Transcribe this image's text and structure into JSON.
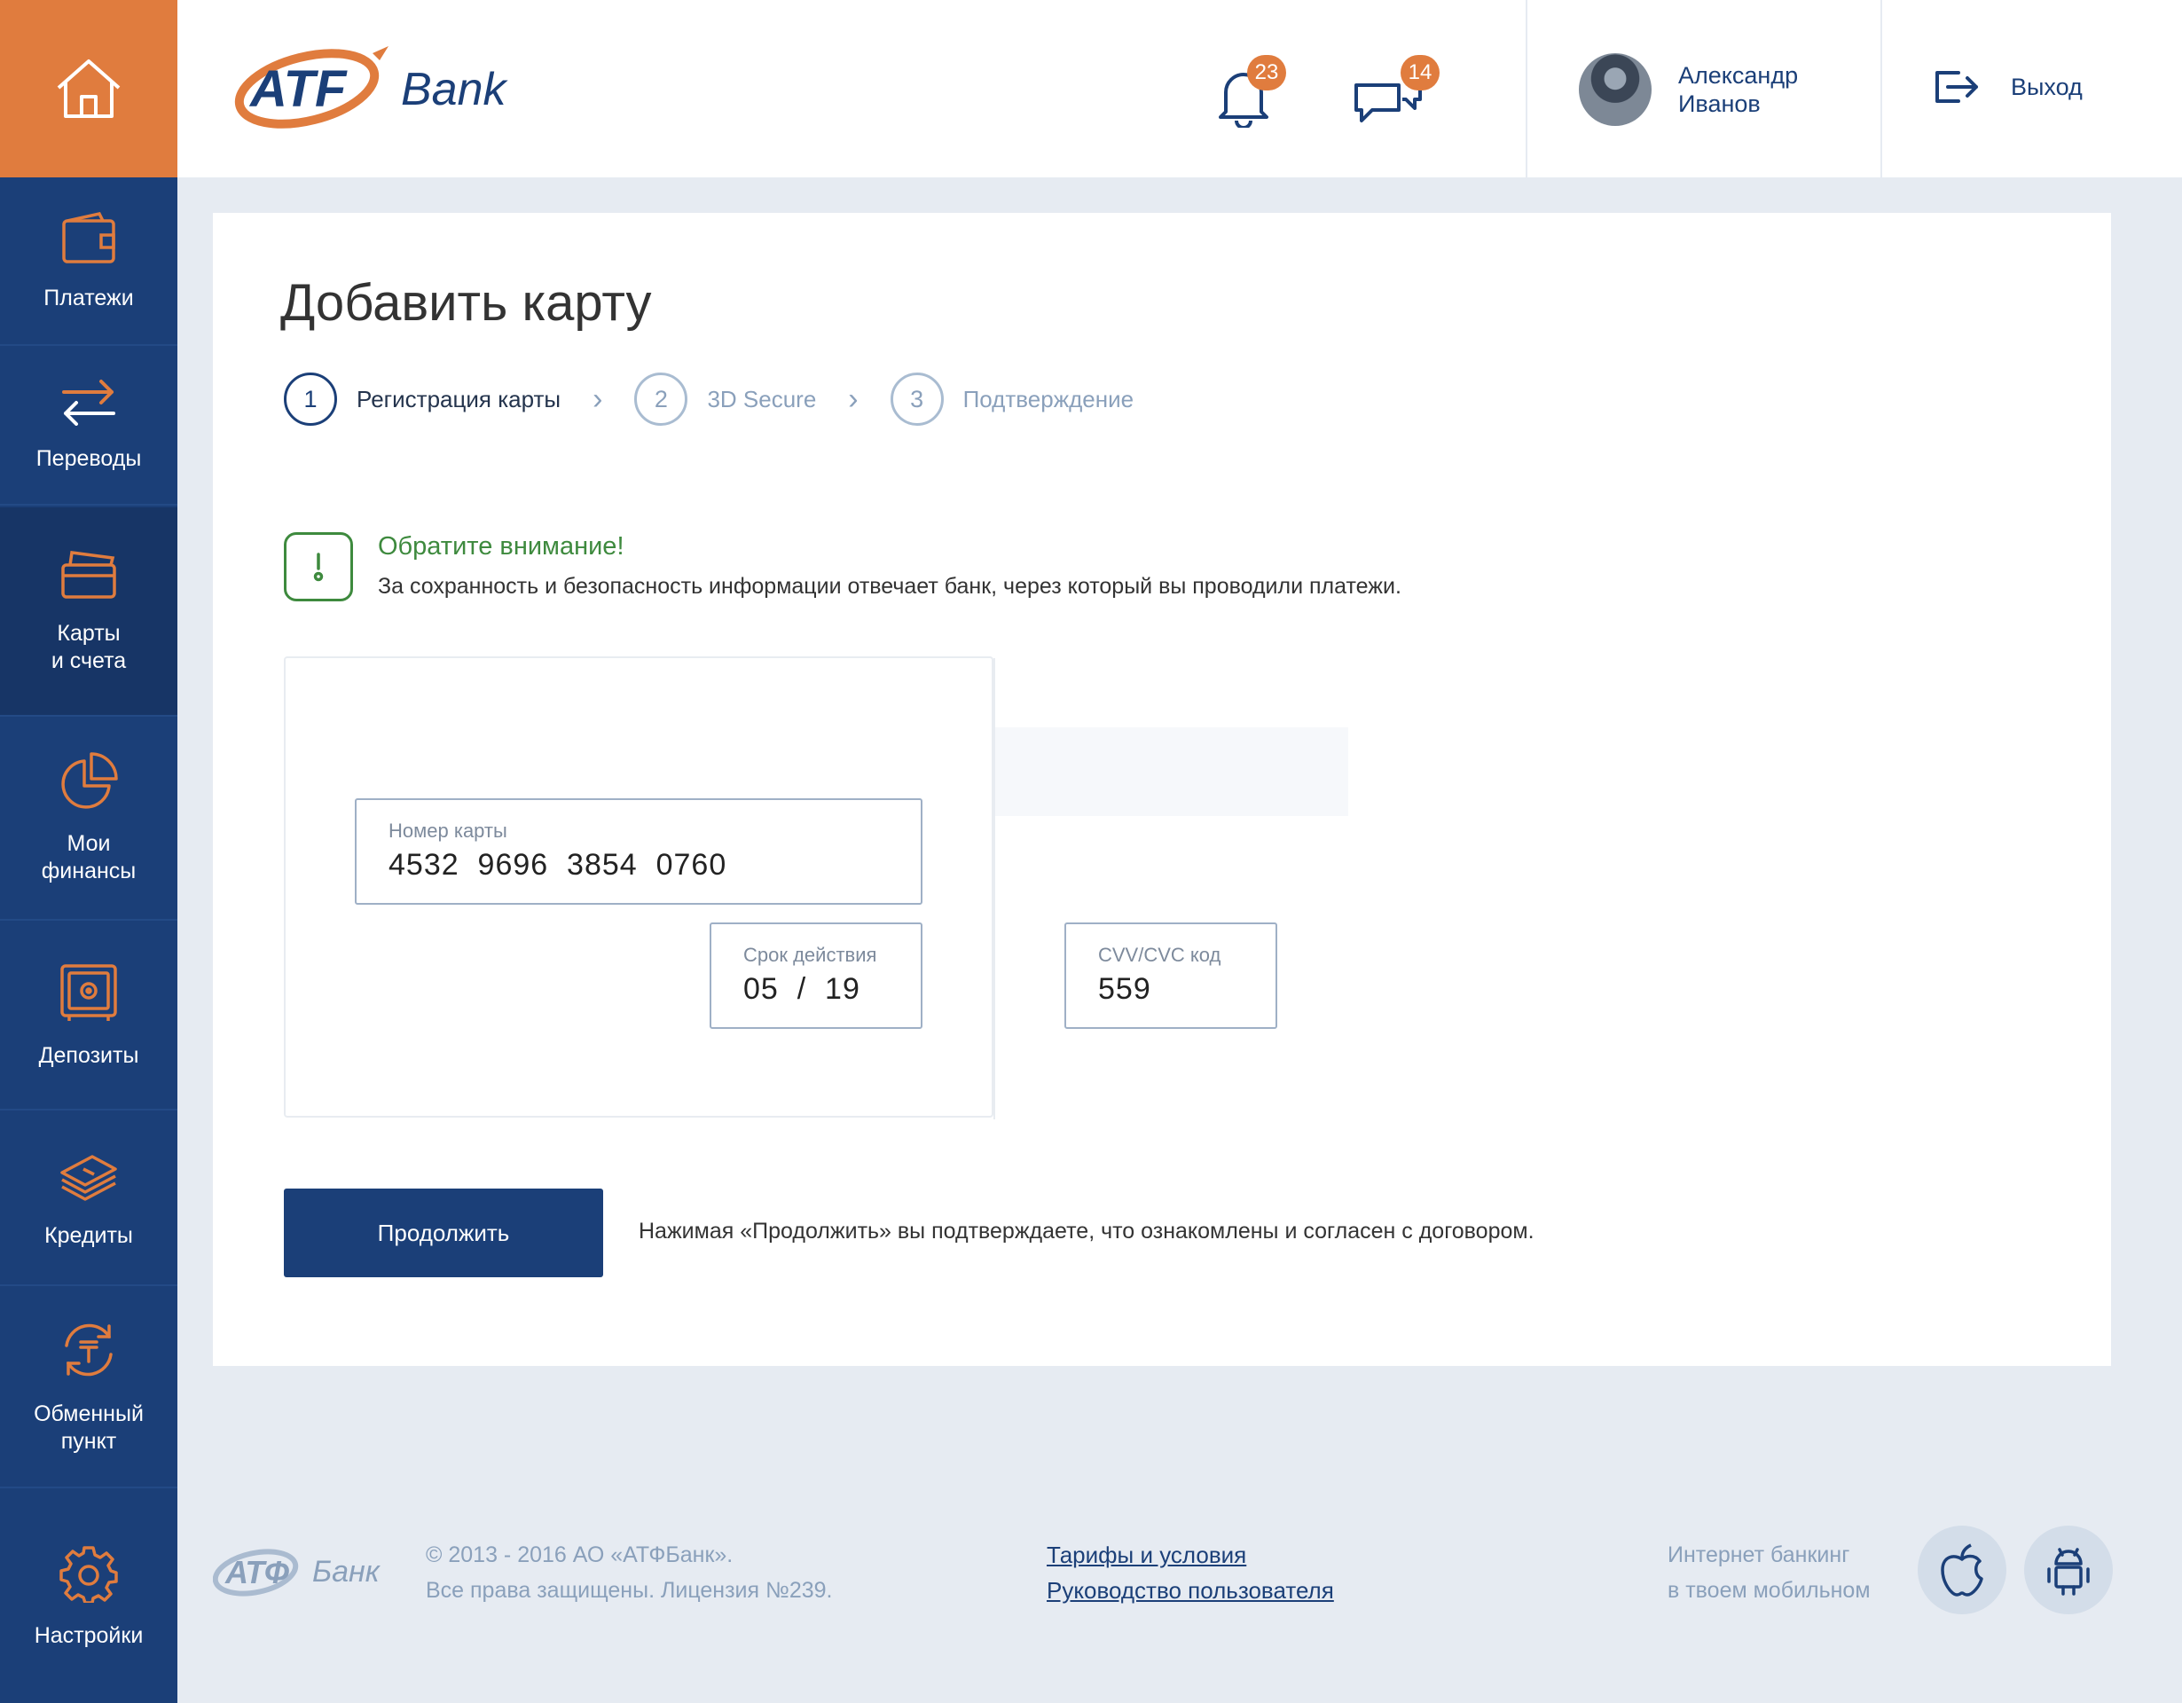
{
  "sidebar": {
    "items": [
      {
        "label": "Платежи"
      },
      {
        "label": "Переводы"
      },
      {
        "label": "Карты\nи счета"
      },
      {
        "label": "Мои\nфинансы"
      },
      {
        "label": "Депозиты"
      },
      {
        "label": "Кредиты"
      },
      {
        "label": "Обменный\nпункт"
      },
      {
        "label": "Настройки"
      }
    ]
  },
  "header": {
    "logo_text": "ATF Bank",
    "notifications_count": "23",
    "messages_count": "14",
    "user_first_name": "Александр",
    "user_last_name": "Иванов",
    "logout_label": "Выход"
  },
  "page": {
    "title": "Добавить карту",
    "steps": [
      {
        "num": "1",
        "label": "Регистрация карты"
      },
      {
        "num": "2",
        "label": "3D Secure"
      },
      {
        "num": "3",
        "label": "Подтверждение"
      }
    ],
    "notice_title": "Обратите внимание!",
    "notice_text": "За сохранность и безопасность информации отвечает банк, через который вы проводили платежи.",
    "card_number_label": "Номер карты",
    "card_number": "4532  9696  3854  0760",
    "expiry_label": "Срок действия",
    "expiry": "05  /  19",
    "cvv_label": "CVV/CVC код",
    "cvv": "559",
    "continue_label": "Продолжить",
    "agree_text": "Нажимая «Продолжить» вы подтверждаете, что ознакомлены и согласен с договором."
  },
  "footer": {
    "logo_text": "АТФ Банк",
    "copyright_line1": "© 2013 - 2016 АО «АТФБанк».",
    "copyright_line2": "Все права защищены. Лицензия №239.",
    "link_tariffs": "Тарифы и условия",
    "link_guide": "Руководство пользователя",
    "mobile_line1": "Интернет банкинг",
    "mobile_line2": "в твоем мобильном"
  },
  "colors": {
    "brand_blue": "#1b3f78",
    "brand_orange": "#e07c3e",
    "notice_green": "#3e8a3e"
  }
}
